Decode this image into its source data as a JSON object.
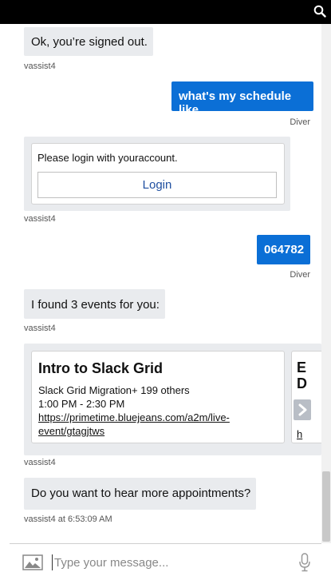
{
  "header": {
    "search_icon": "search-icon"
  },
  "messages": {
    "signed_out": {
      "text": "Ok, you’re signed out.",
      "sender": "vassist4"
    },
    "schedule_query": {
      "text": "what's my schedule like",
      "sender": "Diver"
    },
    "login_card": {
      "prompt": "Please login with youraccount.",
      "button": "Login",
      "sender": "vassist4"
    },
    "code": {
      "text": "064782",
      "sender": "Diver"
    },
    "events_found": {
      "text": "I found 3 events for you:",
      "sender": "vassist4"
    },
    "event_card": {
      "title": "Intro to Slack Grid",
      "attendees": "Slack Grid Migration+ 199 others",
      "time": "1:00 PM - 2:30 PM",
      "link_line1": "https://primetime.bluejeans.com/a2m/live-",
      "link_line2": "event/gtagjtws",
      "sender": "vassist4",
      "next_card_peek": {
        "line1": "E",
        "line2": "D",
        "line3": "h"
      }
    },
    "more_prompt": {
      "text": "Do you want to hear more appointments?",
      "sender": "vassist4 at 6:53:09 AM"
    }
  },
  "composer": {
    "placeholder": "Type your message...",
    "value": ""
  },
  "colors": {
    "accent": "#0b6fd6",
    "bubble_in": "#e9ebee",
    "topbar": "#000000"
  }
}
